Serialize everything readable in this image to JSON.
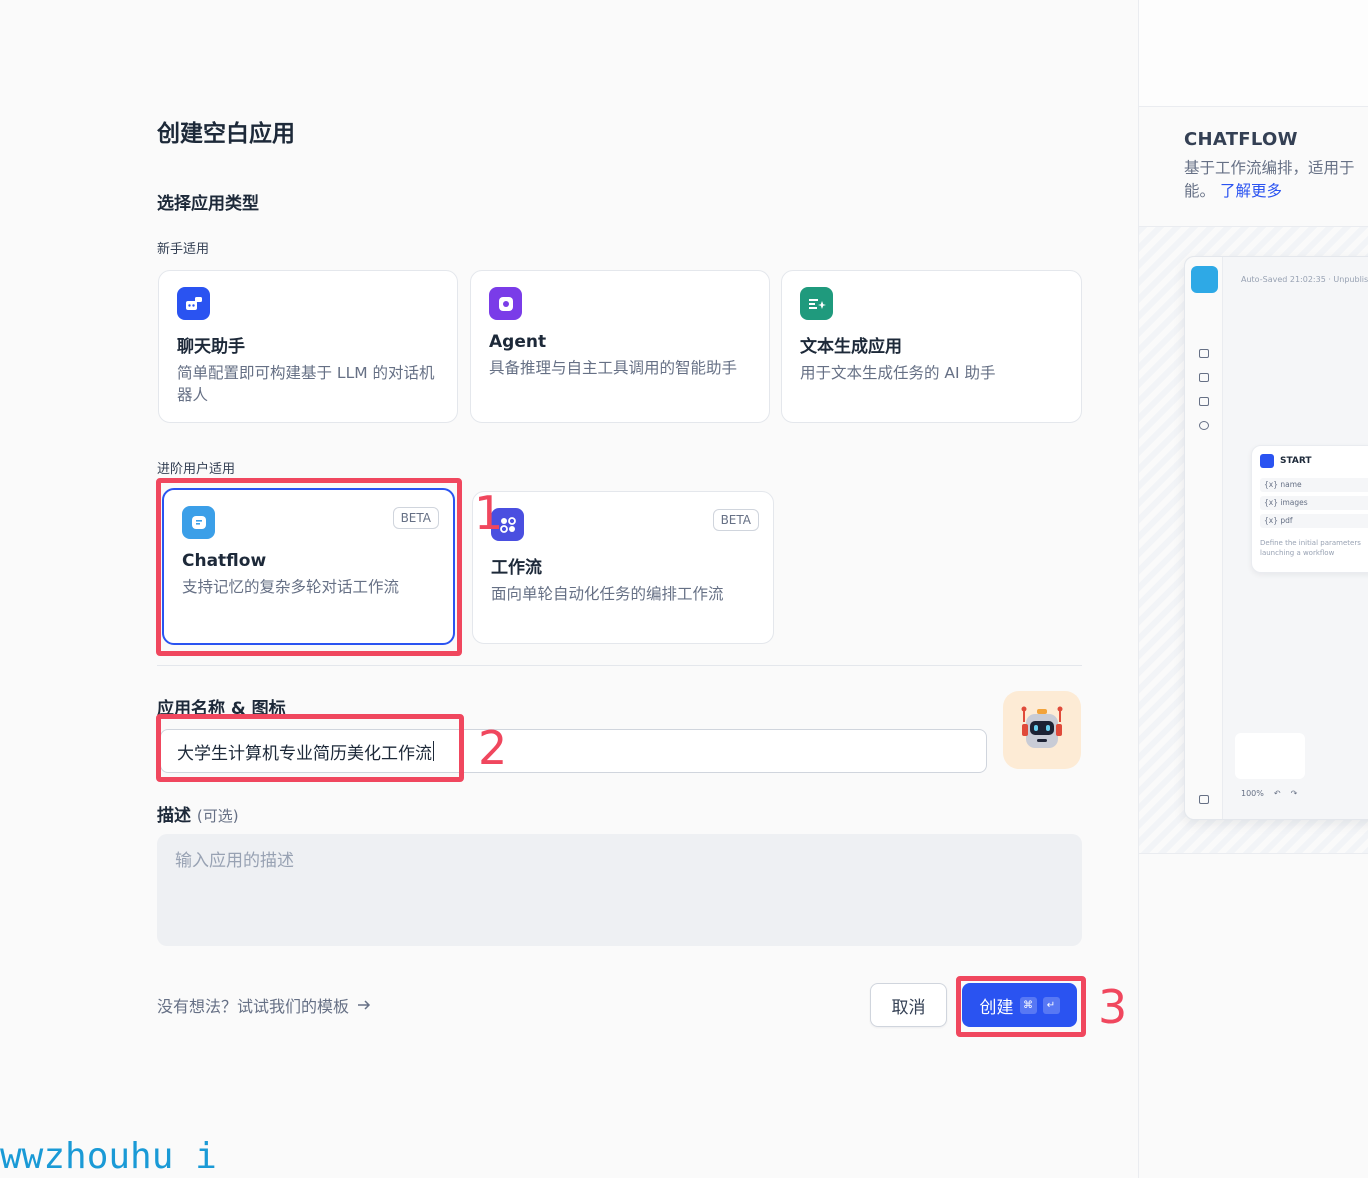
{
  "page_title": "创建空白应用",
  "section_title": "选择应用类型",
  "groups": {
    "beginner": "新手适用",
    "advanced": "进阶用户适用"
  },
  "cards": {
    "chatbot": {
      "name": "聊天助手",
      "desc": "简单配置即可构建基于 LLM 的对话机器人"
    },
    "agent": {
      "name": "Agent",
      "desc": "具备推理与自主工具调用的智能助手"
    },
    "textgen": {
      "name": "文本生成应用",
      "desc": "用于文本生成任务的 AI 助手"
    },
    "chatflow": {
      "name": "Chatflow",
      "desc": "支持记忆的复杂多轮对话工作流",
      "badge": "BETA"
    },
    "workflow": {
      "name": "工作流",
      "desc": "面向单轮自动化任务的编排工作流",
      "badge": "BETA"
    }
  },
  "form": {
    "name_label": "应用名称 & 图标",
    "name_value": "大学生计算机专业简历美化工作流",
    "desc_label": "描述",
    "desc_optional": "(可选)",
    "desc_placeholder": "输入应用的描述"
  },
  "footer": {
    "template_link": "没有想法？试试我们的模板",
    "cancel_label": "取消",
    "create_label": "创建",
    "create_kbd_1": "⌘",
    "create_kbd_2": "↵"
  },
  "annotations": {
    "n1": "1",
    "n2": "2",
    "n3": "3"
  },
  "watermark": "wwzhouhu i",
  "preview": {
    "title": "CHATFLOW",
    "desc_line1": "基于工作流编排，适用于",
    "desc_line2": "能。",
    "learn_more": "了解更多",
    "autosave": "Auto-Saved 21:02:35 · Unpublis",
    "node_title": "START",
    "rows": [
      "{x} name",
      "{x} images",
      "{x} pdf"
    ],
    "node_foot_1": "Define the initial parameters",
    "node_foot_2": "launching a workflow",
    "zoom": "100%"
  },
  "colors": {
    "accent": "#2a53f1",
    "annotation": "#f0475e",
    "watermark": "#1a9ad6"
  }
}
